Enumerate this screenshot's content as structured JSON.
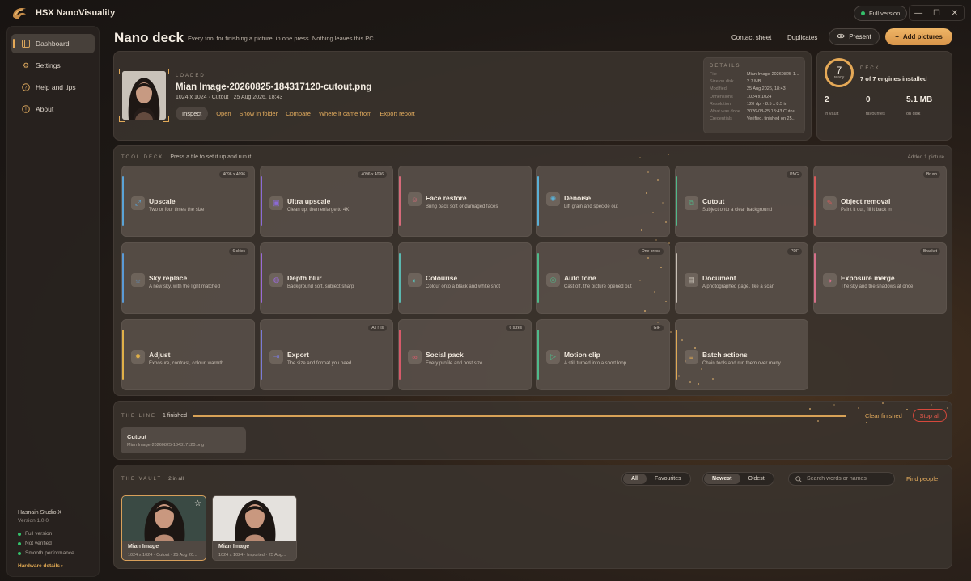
{
  "app": {
    "title": "HSX NanoVisuality",
    "version_badge": "Full version",
    "window_controls": [
      "—",
      "☐",
      "✕"
    ]
  },
  "sidebar": {
    "items": [
      {
        "label": "Dashboard",
        "icon": "dashboard-icon",
        "active": true
      },
      {
        "label": "Settings",
        "icon": "gear-icon",
        "active": false
      },
      {
        "label": "Help and tips",
        "icon": "help-icon",
        "active": false
      },
      {
        "label": "About",
        "icon": "info-icon",
        "active": false
      }
    ],
    "footer": {
      "studio": "Hasnain Studio X",
      "version": "Version 1.0.0",
      "status": [
        "Full version",
        "Not verified",
        "Smooth performance"
      ],
      "link": "Hardware details ›"
    }
  },
  "header": {
    "title": "Nano deck",
    "subtitle": "Every tool for finishing a picture, in one press. Nothing leaves this PC.",
    "contact_sheet": "Contact sheet",
    "duplicates": "Duplicates",
    "present": "Present",
    "add_pictures": "Add pictures"
  },
  "loaded": {
    "caption": "LOADED",
    "filename": "Mian Image-20260825-184317120-cutout.png",
    "meta": "1024 x 1024  ·  Cutout  ·  25 Aug 2026, 18:43",
    "actions": [
      "Inspect",
      "Open",
      "Show in folder",
      "Compare",
      "Where it came from",
      "Export report"
    ],
    "details_caption": "DETAILS",
    "details": [
      {
        "k": "File",
        "v": "Mian Image-20260825-1..."
      },
      {
        "k": "Size on disk",
        "v": "2.7 MB"
      },
      {
        "k": "Modified",
        "v": "25 Aug 2026, 18:43"
      },
      {
        "k": "Dimensions",
        "v": "1024 x 1024"
      },
      {
        "k": "Resolution",
        "v": "120 dpi  ·  8.5 x 8.5 in"
      },
      {
        "k": "What was done",
        "v": "2026-08-25 18:43 Cutou..."
      },
      {
        "k": "Credentials",
        "v": "Verified, finished on 25..."
      }
    ]
  },
  "deck": {
    "ready_count": "7",
    "ready_label": "ready",
    "caption": "DECK",
    "summary": "7 of 7 engines installed",
    "stats": [
      {
        "value": "2",
        "label": "in vault"
      },
      {
        "value": "0",
        "label": "favourites"
      },
      {
        "value": "5.1 MB",
        "label": "on disk"
      }
    ]
  },
  "tool_deck": {
    "caption": "TOOL DECK",
    "hint": "Press a tile to set it up and run it",
    "added": "Added 1 picture",
    "tiles": [
      {
        "name": "Upscale",
        "desc": "Two or four times the size",
        "tag": "4096 x 4096",
        "icon": "upscale-icon",
        "glyph": "⤢",
        "accent": "#5aa3d6"
      },
      {
        "name": "Ultra upscale",
        "desc": "Clean up, then enlarge to 4K",
        "tag": "4096 x 4096",
        "icon": "ultra-upscale-icon",
        "glyph": "▣",
        "accent": "#8b6ad6"
      },
      {
        "name": "Face restore",
        "desc": "Bring back soft or damaged faces",
        "tag": "",
        "icon": "face-restore-icon",
        "glyph": "☺",
        "accent": "#d66a7a"
      },
      {
        "name": "Denoise",
        "desc": "Lift grain and speckle out",
        "tag": "",
        "icon": "denoise-icon",
        "glyph": "✺",
        "accent": "#5ab0d6"
      },
      {
        "name": "Cutout",
        "desc": "Subject onto a clear background",
        "tag": "PNG",
        "icon": "cutout-icon",
        "glyph": "⧉",
        "accent": "#4fb98a"
      },
      {
        "name": "Object removal",
        "desc": "Paint it out, fill it back in",
        "tag": "Brush",
        "icon": "object-removal-icon",
        "glyph": "✎",
        "accent": "#d65a5a"
      },
      {
        "name": "Sky replace",
        "desc": "A new sky, with the light matched",
        "tag": "6 skies",
        "icon": "sky-replace-icon",
        "glyph": "☼",
        "accent": "#5a9ad6"
      },
      {
        "name": "Depth blur",
        "desc": "Background soft, subject sharp",
        "tag": "",
        "icon": "depth-blur-icon",
        "glyph": "◍",
        "accent": "#9a6ad6"
      },
      {
        "name": "Colourise",
        "desc": "Colour onto a black and white shot",
        "tag": "",
        "icon": "colourise-icon",
        "glyph": "◐",
        "accent": "#5ab8b0"
      },
      {
        "name": "Auto tone",
        "desc": "Cast off, the picture opened out",
        "tag": "One press",
        "icon": "auto-tone-icon",
        "glyph": "◎",
        "accent": "#4fb98a"
      },
      {
        "name": "Document",
        "desc": "A photographed page, like a scan",
        "tag": "PDF",
        "icon": "document-icon",
        "glyph": "▤",
        "accent": "#c8c0b6"
      },
      {
        "name": "Exposure merge",
        "desc": "The sky and the shadows at once",
        "tag": "Bracket",
        "icon": "exposure-merge-icon",
        "glyph": "◑",
        "accent": "#d6708a"
      },
      {
        "name": "Adjust",
        "desc": "Exposure, contrast, colour, warmth",
        "tag": "",
        "icon": "adjust-icon",
        "glyph": "✹",
        "accent": "#e0b048"
      },
      {
        "name": "Export",
        "desc": "The size and format you need",
        "tag": "As it is",
        "icon": "export-icon",
        "glyph": "⇥",
        "accent": "#7a7ad6"
      },
      {
        "name": "Social pack",
        "desc": "Every profile and post size",
        "tag": "6 sizes",
        "icon": "social-pack-icon",
        "glyph": "∞",
        "accent": "#d65a6a"
      },
      {
        "name": "Motion clip",
        "desc": "A still turned into a short loop",
        "tag": "GIF",
        "icon": "motion-clip-icon",
        "glyph": "▷",
        "accent": "#4fb98a"
      },
      {
        "name": "Batch actions",
        "desc": "Chain tools and run them over many",
        "tag": "",
        "icon": "batch-actions-icon",
        "glyph": "≡",
        "accent": "#e0a953"
      }
    ]
  },
  "the_line": {
    "caption": "THE LINE",
    "count": "1 finished",
    "clear": "Clear finished",
    "stop": "Stop all",
    "progress": 1.0,
    "job": {
      "title": "Cutout",
      "file": "Mian Image-20260825-184317120.png"
    }
  },
  "vault": {
    "caption": "THE VAULT",
    "count": "2 in all",
    "filter": [
      "All",
      "Favourites"
    ],
    "sort": [
      "Newest",
      "Oldest"
    ],
    "search_placeholder": "Search words or names",
    "find_people": "Find people",
    "cards": [
      {
        "name": "Mian Image",
        "meta": "1024 x 1024  ·  Cutout  ·  25 Aug 20..."
      },
      {
        "name": "Mian Image",
        "meta": "1024 x 1024  ·  Imported  ·  25 Aug..."
      }
    ]
  },
  "colors": {
    "accent": "#e5a957",
    "danger": "#ec5a4c",
    "ok": "#34c06a"
  }
}
